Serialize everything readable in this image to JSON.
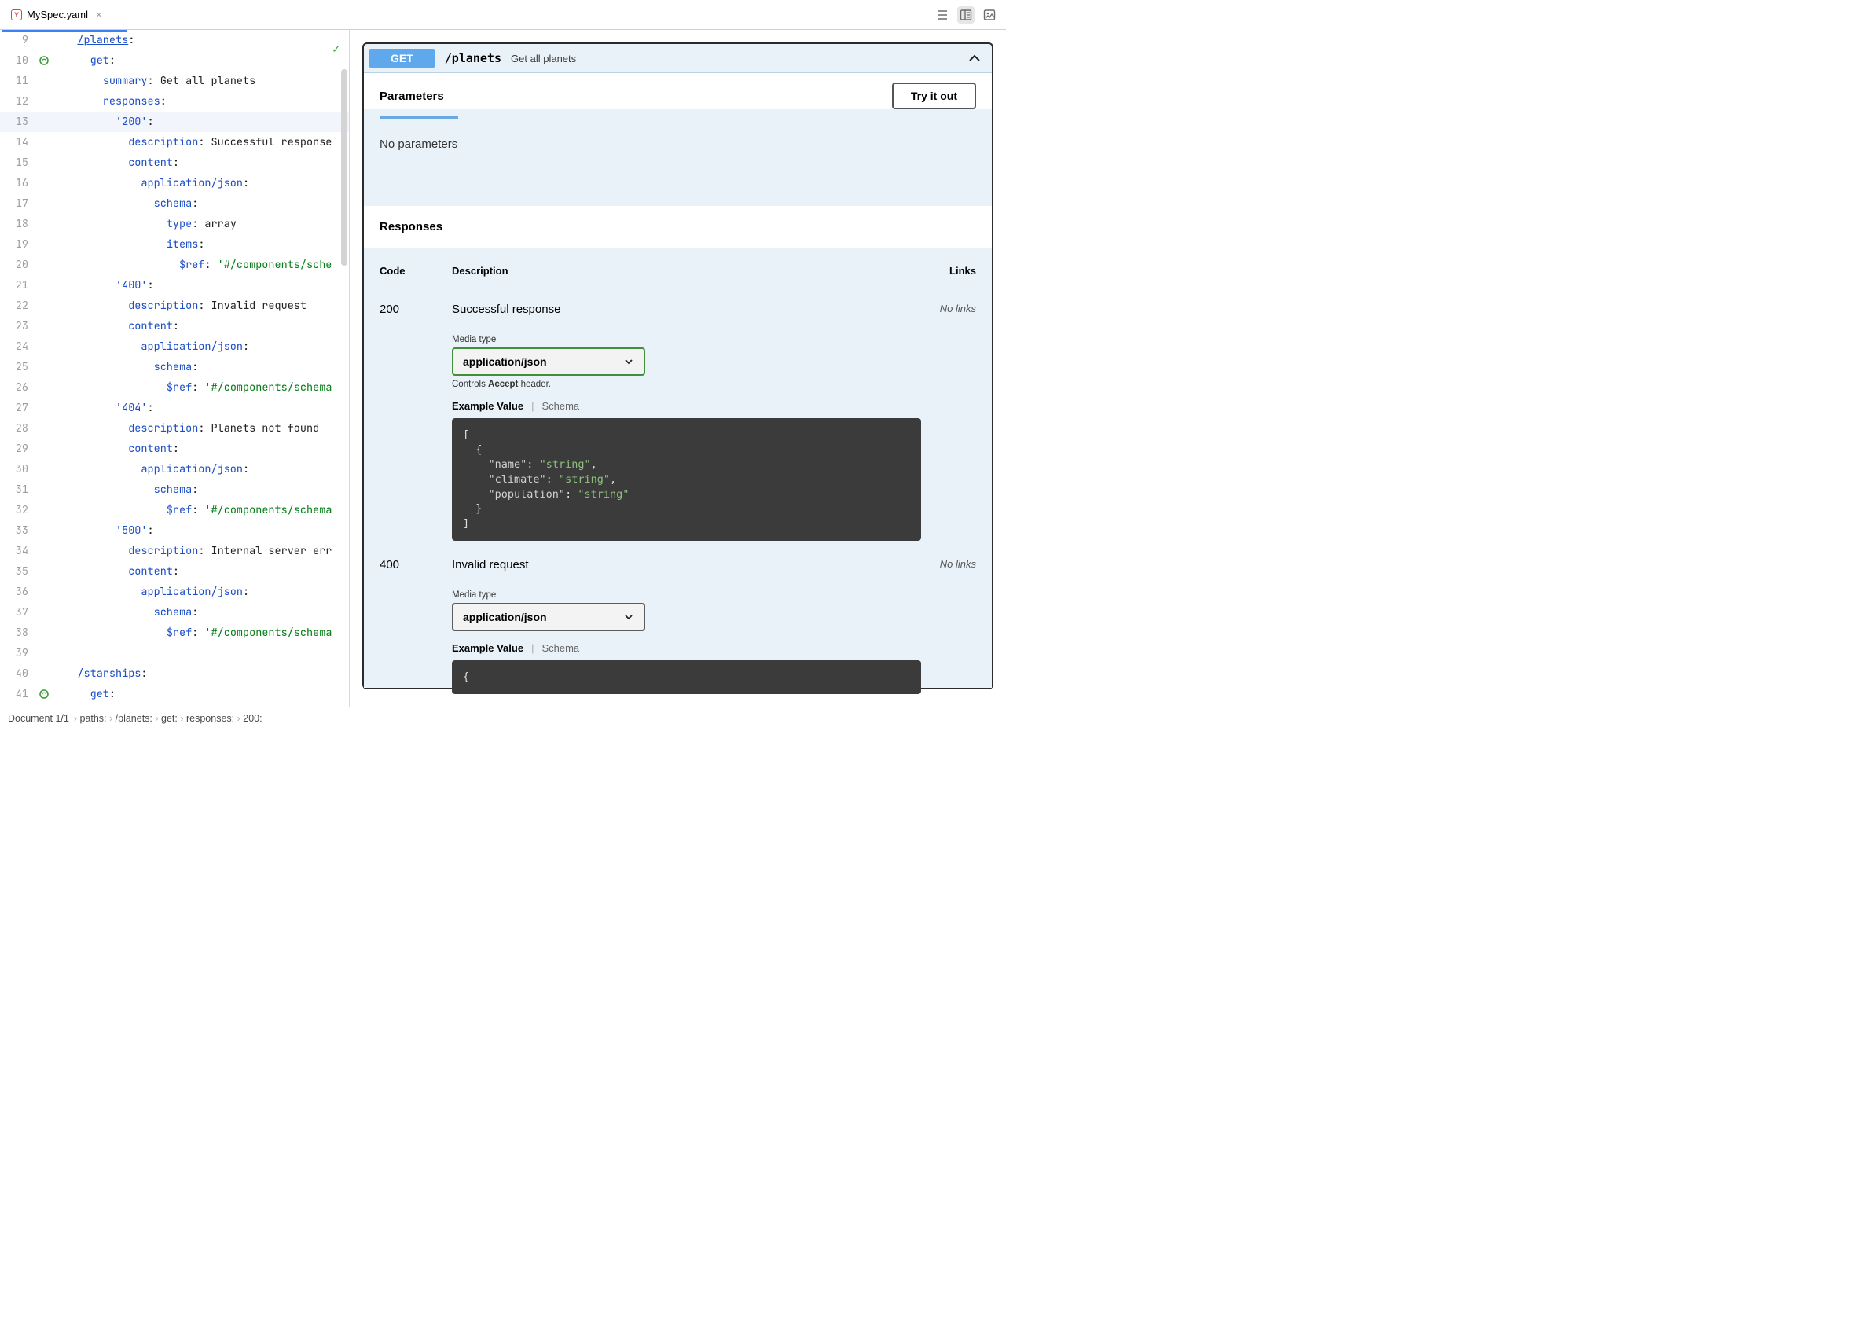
{
  "tab": {
    "filename": "MySpec.yaml",
    "icon_label": "Y"
  },
  "toolbar": {
    "items": [
      "list-icon",
      "split-preview-icon",
      "image-icon"
    ]
  },
  "editor": {
    "check_ok": true,
    "lines": [
      {
        "n": 9,
        "indent": 2,
        "tokens": [
          [
            "/planets",
            "path"
          ],
          [
            ":",
            "plain"
          ]
        ]
      },
      {
        "n": 10,
        "indent": 3,
        "gut": "endpoint",
        "tokens": [
          [
            "get",
            "key"
          ],
          [
            ":",
            "plain"
          ]
        ]
      },
      {
        "n": 11,
        "indent": 4,
        "tokens": [
          [
            "summary",
            "key"
          ],
          [
            ": Get all planets",
            "plain"
          ]
        ]
      },
      {
        "n": 12,
        "indent": 4,
        "tokens": [
          [
            "responses",
            "key"
          ],
          [
            ":",
            "plain"
          ]
        ]
      },
      {
        "n": 13,
        "indent": 5,
        "hl": true,
        "tokens": [
          [
            "'200'",
            "key"
          ],
          [
            ":",
            "plain"
          ]
        ]
      },
      {
        "n": 14,
        "indent": 6,
        "tokens": [
          [
            "description",
            "key"
          ],
          [
            ": Successful response",
            "plain"
          ]
        ]
      },
      {
        "n": 15,
        "indent": 6,
        "tokens": [
          [
            "content",
            "key"
          ],
          [
            ":",
            "plain"
          ]
        ]
      },
      {
        "n": 16,
        "indent": 7,
        "tokens": [
          [
            "application/json",
            "key"
          ],
          [
            ":",
            "plain"
          ]
        ]
      },
      {
        "n": 17,
        "indent": 8,
        "tokens": [
          [
            "schema",
            "key"
          ],
          [
            ":",
            "plain"
          ]
        ]
      },
      {
        "n": 18,
        "indent": 9,
        "tokens": [
          [
            "type",
            "key"
          ],
          [
            ": array",
            "plain"
          ]
        ]
      },
      {
        "n": 19,
        "indent": 9,
        "tokens": [
          [
            "items",
            "key"
          ],
          [
            ":",
            "plain"
          ]
        ]
      },
      {
        "n": 20,
        "indent": 10,
        "tokens": [
          [
            "$ref",
            "key"
          ],
          [
            ": ",
            "plain"
          ],
          [
            "'#/components/sche",
            "str"
          ]
        ]
      },
      {
        "n": 21,
        "indent": 5,
        "tokens": [
          [
            "'400'",
            "key"
          ],
          [
            ":",
            "plain"
          ]
        ]
      },
      {
        "n": 22,
        "indent": 6,
        "tokens": [
          [
            "description",
            "key"
          ],
          [
            ": Invalid request",
            "plain"
          ]
        ]
      },
      {
        "n": 23,
        "indent": 6,
        "tokens": [
          [
            "content",
            "key"
          ],
          [
            ":",
            "plain"
          ]
        ]
      },
      {
        "n": 24,
        "indent": 7,
        "tokens": [
          [
            "application/json",
            "key"
          ],
          [
            ":",
            "plain"
          ]
        ]
      },
      {
        "n": 25,
        "indent": 8,
        "tokens": [
          [
            "schema",
            "key"
          ],
          [
            ":",
            "plain"
          ]
        ]
      },
      {
        "n": 26,
        "indent": 9,
        "tokens": [
          [
            "$ref",
            "key"
          ],
          [
            ": ",
            "plain"
          ],
          [
            "'#/components/schema",
            "str"
          ]
        ]
      },
      {
        "n": 27,
        "indent": 5,
        "tokens": [
          [
            "'404'",
            "key"
          ],
          [
            ":",
            "plain"
          ]
        ]
      },
      {
        "n": 28,
        "indent": 6,
        "tokens": [
          [
            "description",
            "key"
          ],
          [
            ": Planets not found",
            "plain"
          ]
        ]
      },
      {
        "n": 29,
        "indent": 6,
        "tokens": [
          [
            "content",
            "key"
          ],
          [
            ":",
            "plain"
          ]
        ]
      },
      {
        "n": 30,
        "indent": 7,
        "tokens": [
          [
            "application/json",
            "key"
          ],
          [
            ":",
            "plain"
          ]
        ]
      },
      {
        "n": 31,
        "indent": 8,
        "tokens": [
          [
            "schema",
            "key"
          ],
          [
            ":",
            "plain"
          ]
        ]
      },
      {
        "n": 32,
        "indent": 9,
        "tokens": [
          [
            "$ref",
            "key"
          ],
          [
            ": ",
            "plain"
          ],
          [
            "'#/components/schema",
            "str"
          ]
        ]
      },
      {
        "n": 33,
        "indent": 5,
        "tokens": [
          [
            "'500'",
            "key"
          ],
          [
            ":",
            "plain"
          ]
        ]
      },
      {
        "n": 34,
        "indent": 6,
        "tokens": [
          [
            "description",
            "key"
          ],
          [
            ": Internal server err",
            "plain"
          ]
        ]
      },
      {
        "n": 35,
        "indent": 6,
        "tokens": [
          [
            "content",
            "key"
          ],
          [
            ":",
            "plain"
          ]
        ]
      },
      {
        "n": 36,
        "indent": 7,
        "tokens": [
          [
            "application/json",
            "key"
          ],
          [
            ":",
            "plain"
          ]
        ]
      },
      {
        "n": 37,
        "indent": 8,
        "tokens": [
          [
            "schema",
            "key"
          ],
          [
            ":",
            "plain"
          ]
        ]
      },
      {
        "n": 38,
        "indent": 9,
        "tokens": [
          [
            "$ref",
            "key"
          ],
          [
            ": ",
            "plain"
          ],
          [
            "'#/components/schema",
            "str"
          ]
        ]
      },
      {
        "n": 39,
        "indent": 0,
        "tokens": []
      },
      {
        "n": 40,
        "indent": 2,
        "tokens": [
          [
            "/starships",
            "path"
          ],
          [
            ":",
            "plain"
          ]
        ]
      },
      {
        "n": 41,
        "indent": 3,
        "gut": "endpoint",
        "tokens": [
          [
            "get",
            "key"
          ],
          [
            ":",
            "plain"
          ]
        ]
      }
    ]
  },
  "preview": {
    "method": "GET",
    "path": "/planets",
    "summary": "Get all planets",
    "parameters_title": "Parameters",
    "try_button": "Try it out",
    "no_params": "No parameters",
    "responses_title": "Responses",
    "columns": {
      "code": "Code",
      "desc": "Description",
      "links": "Links"
    },
    "media_label": "Media type",
    "media_value": "application/json",
    "controls_note_pre": "Controls ",
    "controls_note_b": "Accept",
    "controls_note_post": " header.",
    "example_tab": "Example Value",
    "schema_tab": "Schema",
    "rows": [
      {
        "code": "200",
        "desc": "Successful response",
        "links": "No links",
        "has_note": true,
        "example": "[\n  {\n    \"name\": \"string\",\n    \"climate\": \"string\",\n    \"population\": \"string\"\n  }\n]"
      },
      {
        "code": "400",
        "desc": "Invalid request",
        "links": "No links",
        "has_note": false,
        "example": "{"
      }
    ]
  },
  "breadcrumb": {
    "doc_pos": "Document 1/1",
    "items": [
      "paths:",
      "/planets:",
      "get:",
      "responses:",
      "200:"
    ]
  }
}
